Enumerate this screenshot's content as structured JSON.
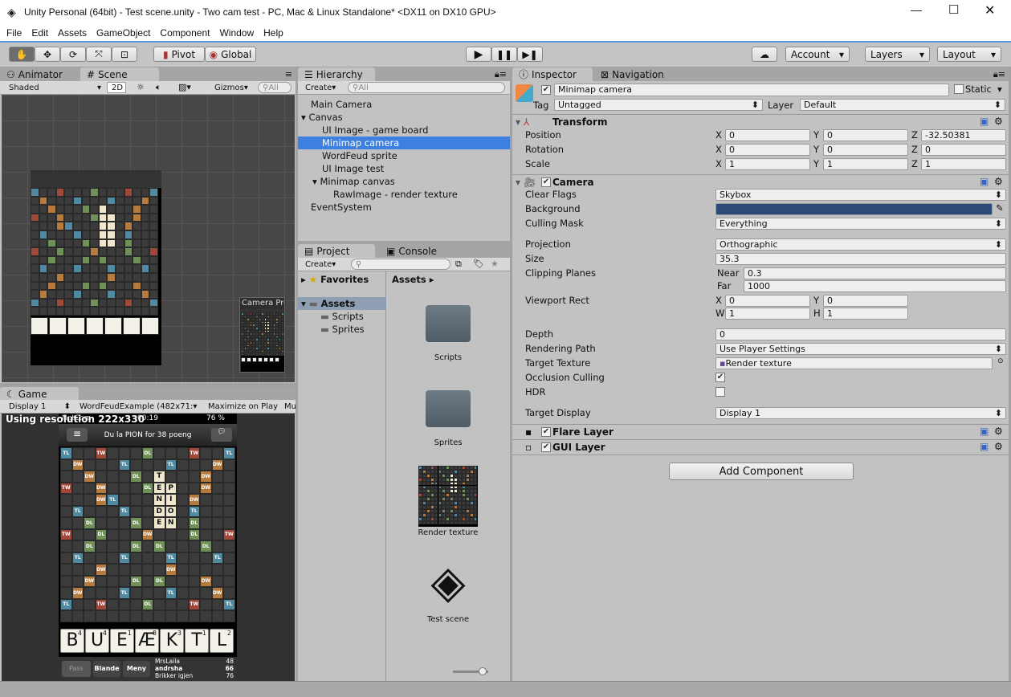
{
  "window": {
    "title": "Unity Personal (64bit) - Test scene.unity - Two cam test - PC, Mac & Linux Standalone* <DX11 on DX10 GPU>"
  },
  "menu": [
    "File",
    "Edit",
    "Assets",
    "GameObject",
    "Component",
    "Window",
    "Help"
  ],
  "toolbar": {
    "pivot": "Pivot",
    "global": "Global",
    "account": "Account",
    "layers": "Layers",
    "layout": "Layout"
  },
  "scene": {
    "tabs": [
      "Animator",
      "Scene"
    ],
    "shading": "Shaded",
    "mode2d": "2D",
    "gizmos": "Gizmos",
    "search_placeholder": "All",
    "camera_preview": "Camera Preview"
  },
  "game": {
    "tab": "Game",
    "display": "Display 1",
    "resolution": "WordFeudExample (482x71:",
    "maximize": "Maximize on Play",
    "mute": "Mu",
    "overlay": "Using resolution 222x330"
  },
  "phone": {
    "carrier": "NetCom",
    "time": "00:19",
    "battery": "76 %",
    "message": "Du la PION for 38 poeng",
    "board_rows": [
      "a..c...b...c..a",
      ".e...a...a...e.",
      "..e...b.T...e..",
      "c..e...bEP..e..",
      "...ea...NI.e...",
      ".a...a..DO.a...",
      "..b...b.EN.b...",
      "c..b...e...b..c",
      "..b...b.b...b..",
      ".a...a...a...a..",
      "...e.....e.....",
      "..e...b.b...e..",
      ".e...a...a...e.",
      "a..c...b...c..a",
      "..............."
    ],
    "bonus_labels": {
      "a": "TL",
      "b": "DL",
      "c": "TW",
      "e": "DW"
    },
    "bonus_colors": {
      "a": "#4f8aa0",
      "b": "#6f9158",
      "c": "#a0483a",
      "e": "#b47a3e"
    },
    "rack": [
      {
        "l": "B",
        "s": "4"
      },
      {
        "l": "U",
        "s": "4"
      },
      {
        "l": "E",
        "s": "1"
      },
      {
        "l": "Æ",
        "s": "8"
      },
      {
        "l": "K",
        "s": "3"
      },
      {
        "l": "T",
        "s": "1"
      },
      {
        "l": "L",
        "s": "2"
      }
    ],
    "buttons": [
      "Pass",
      "Blande",
      "Meny"
    ],
    "scores": [
      {
        "n": "MrsLaila",
        "v": "48"
      },
      {
        "n": "andrsha",
        "v": "66"
      },
      {
        "n": "Brikker igjen",
        "v": "76"
      }
    ]
  },
  "hierarchy": {
    "tab": "Hierarchy",
    "create": "Create",
    "search_placeholder": "All",
    "items": [
      {
        "label": "Main Camera",
        "depth": 0
      },
      {
        "label": "Canvas",
        "depth": 0,
        "arrow": true
      },
      {
        "label": "UI Image - game board",
        "depth": 1
      },
      {
        "label": "Minimap camera",
        "depth": 1,
        "selected": true
      },
      {
        "label": "WordFeud sprite",
        "depth": 1
      },
      {
        "label": "UI Image test",
        "depth": 1
      },
      {
        "label": "Minimap canvas",
        "depth": 1,
        "arrow": true
      },
      {
        "label": "RawImage - render texture",
        "depth": 2
      },
      {
        "label": "EventSystem",
        "depth": 0
      }
    ]
  },
  "project": {
    "tabs": [
      "Project",
      "Console"
    ],
    "create": "Create",
    "favorites": "Favorites",
    "assets": "Assets",
    "folders": [
      "Scripts",
      "Sprites"
    ],
    "breadcrumb": "Assets",
    "items": [
      {
        "label": "Scripts",
        "type": "folder"
      },
      {
        "label": "Sprites",
        "type": "folder"
      },
      {
        "label": "Render texture",
        "type": "texture"
      },
      {
        "label": "Test scene",
        "type": "unity"
      }
    ]
  },
  "inspector": {
    "tabs": [
      "Inspector",
      "Navigation"
    ],
    "name": "Minimap camera",
    "static": "Static",
    "tag_label": "Tag",
    "tag": "Untagged",
    "layer_label": "Layer",
    "layer": "Default",
    "transform": {
      "title": "Transform",
      "position": {
        "label": "Position",
        "x": "0",
        "y": "0",
        "z": "-32.50381"
      },
      "rotation": {
        "label": "Rotation",
        "x": "0",
        "y": "0",
        "z": "0"
      },
      "scale": {
        "label": "Scale",
        "x": "1",
        "y": "1",
        "z": "1"
      }
    },
    "camera": {
      "title": "Camera",
      "clear_flags": [
        "Clear Flags",
        "Skybox"
      ],
      "background": [
        "Background",
        "#2c4a78"
      ],
      "culling_mask": [
        "Culling Mask",
        "Everything"
      ],
      "projection": [
        "Projection",
        "Orthographic"
      ],
      "size": [
        "Size",
        "35.3"
      ],
      "clipping": {
        "label": "Clipping Planes",
        "near_label": "Near",
        "near": "0.3",
        "far_label": "Far",
        "far": "1000"
      },
      "viewport": {
        "label": "Viewport Rect",
        "x": "0",
        "y": "0",
        "w": "1",
        "h": "1"
      },
      "depth": [
        "Depth",
        "0"
      ],
      "rendering_path": [
        "Rendering Path",
        "Use Player Settings"
      ],
      "target_texture": [
        "Target Texture",
        "Render texture"
      ],
      "occlusion": [
        "Occlusion Culling",
        true
      ],
      "hdr": [
        "HDR",
        false
      ],
      "target_display": [
        "Target Display",
        "Display 1"
      ]
    },
    "flare": "Flare Layer",
    "gui": "GUI Layer",
    "add_component": "Add Component"
  }
}
